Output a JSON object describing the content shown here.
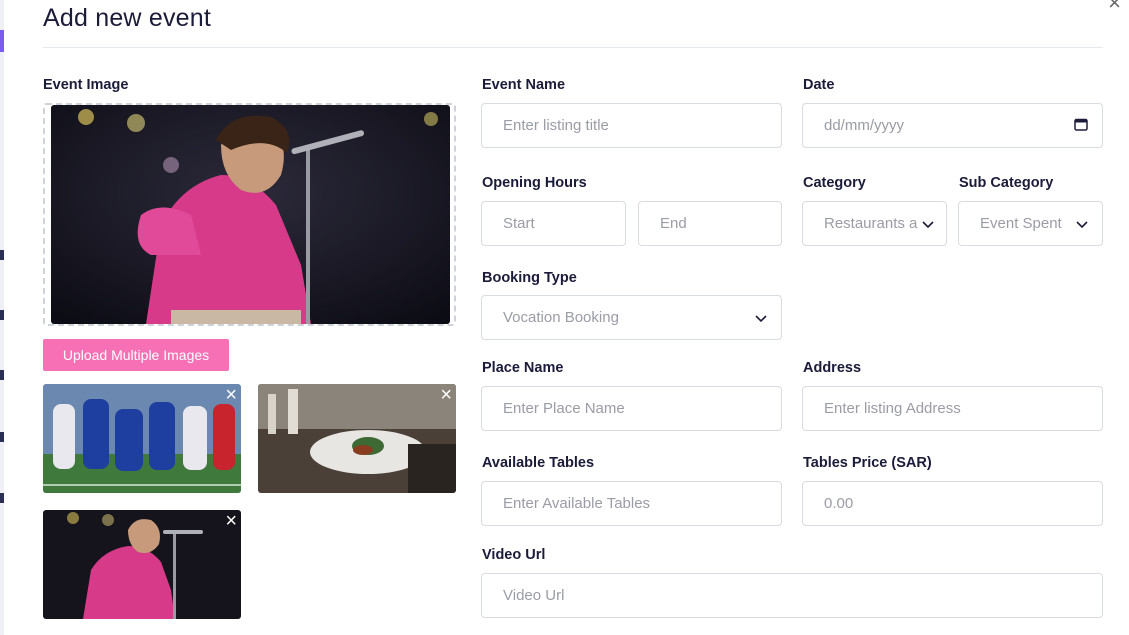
{
  "modal": {
    "title": "Add new event"
  },
  "labels": {
    "event_image": "Event Image",
    "event_name": "Event Name",
    "date": "Date",
    "opening_hours": "Opening Hours",
    "category": "Category",
    "sub_category": "Sub Category",
    "booking_type": "Booking Type",
    "place_name": "Place Name",
    "address": "Address",
    "available_tables": "Available Tables",
    "tables_price": "Tables Price (SAR)",
    "video_url": "Video Url"
  },
  "fields": {
    "event_name_placeholder": "Enter listing title",
    "date_placeholder": "dd/mm/yyyy",
    "start_placeholder": "Start",
    "end_placeholder": "End",
    "category_value": "Restaurants an",
    "sub_category_value": "Event Spent",
    "booking_type_value": "Vocation Booking",
    "place_name_placeholder": "Enter Place Name",
    "address_placeholder": "Enter listing Address",
    "available_tables_placeholder": "Enter Available Tables",
    "tables_price_placeholder": "0.00",
    "video_url_placeholder": "Video Url"
  },
  "buttons": {
    "upload": "Upload Multiple Images"
  },
  "icons": {
    "close": "×",
    "thumb_remove": "×",
    "calendar": "calendar-icon",
    "chevron": "chevron-down-icon"
  },
  "colors": {
    "accent": "#f76fb5",
    "text": "#1b1b3a",
    "placeholder": "#9a9ca6",
    "border": "#d9dce3"
  }
}
